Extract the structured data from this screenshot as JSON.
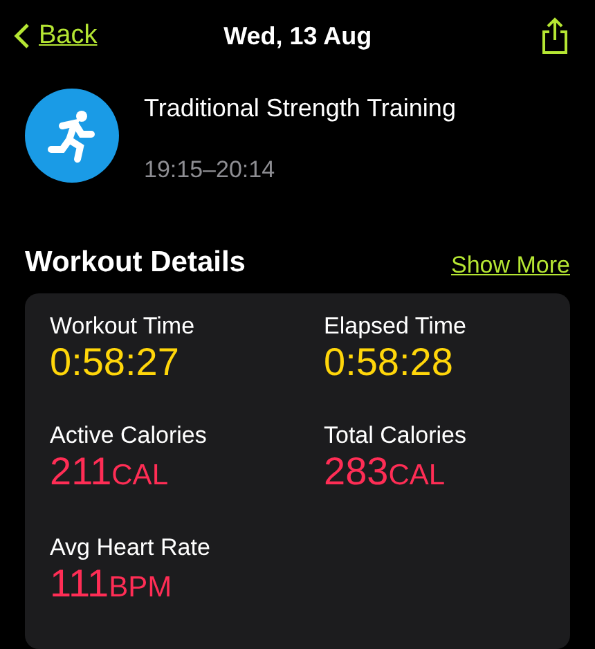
{
  "nav": {
    "back": "Back",
    "title": "Wed, 13 Aug"
  },
  "workout": {
    "name": "Traditional Strength Training",
    "time": "19:15–20:14"
  },
  "section": {
    "title": "Workout Details",
    "action": "Show More"
  },
  "metrics": [
    {
      "label": "Workout Time",
      "value": "0:58:27",
      "color": "#ffd60a"
    },
    {
      "label": "Elapsed Time",
      "value": "0:58:28",
      "color": "#ffd60a"
    },
    {
      "label": "Active Calories",
      "value": "211",
      "unit": "CAL",
      "color": "#ff2d55"
    },
    {
      "label": "Total Calories",
      "value": "283",
      "unit": "CAL",
      "color": "#ff2d55"
    },
    {
      "label": "Avg Heart Rate",
      "value": "111",
      "unit": "BPM",
      "color": "#ff2d55"
    }
  ]
}
